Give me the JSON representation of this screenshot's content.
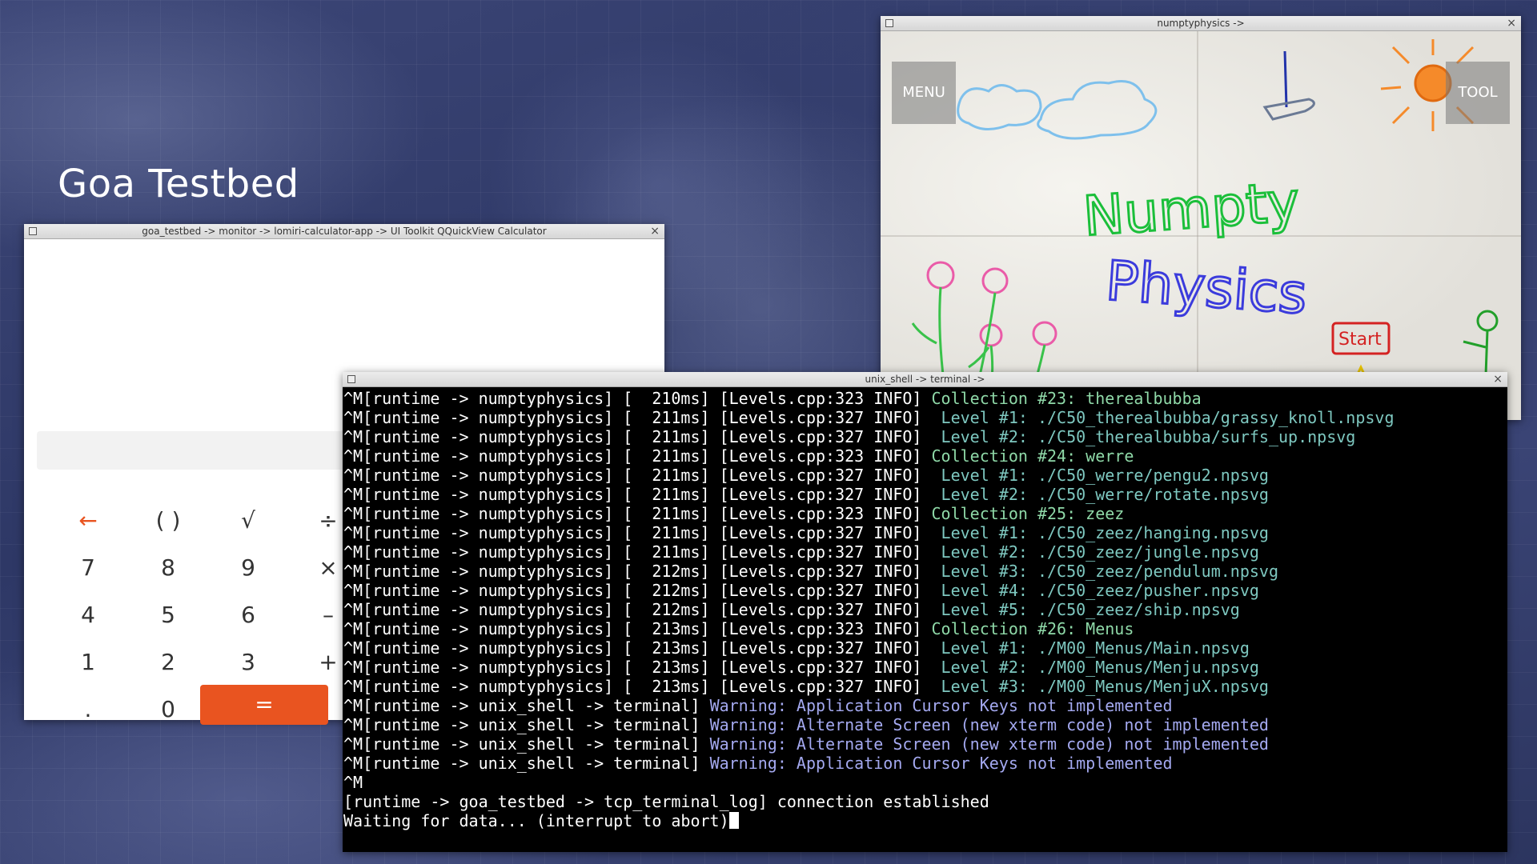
{
  "desktop": {
    "title": "Goa Testbed"
  },
  "calculator": {
    "window_title": "goa_testbed -> monitor -> lomiri-calculator-app -> UI Toolkit QQuickView Calculator",
    "close_label": "×",
    "keys": {
      "backspace": "←",
      "parens": "( )",
      "sqrt": "√",
      "divide": "÷",
      "k7": "7",
      "k8": "8",
      "k9": "9",
      "multiply": "×",
      "k4": "4",
      "k5": "5",
      "k6": "6",
      "minus": "–",
      "k1": "1",
      "k2": "2",
      "k3": "3",
      "plus": "+",
      "dot": ".",
      "k0": "0",
      "equals": "="
    },
    "accent": "#e95420"
  },
  "numpty": {
    "window_title": "numptyphysics ->",
    "close_label": "×",
    "menu_label": "MENU",
    "tool_label": "TOOL",
    "logo_line1": "Numpty",
    "logo_line2": "Physics",
    "start_label": "Start"
  },
  "terminal": {
    "window_title": "unix_shell -> terminal ->",
    "close_label": "×",
    "lines": [
      {
        "prefix": "^M[runtime -> numptyphysics] [  210ms] [Levels.cpp:323 INFO] ",
        "msg": "Collection #23: therealbubba",
        "kind": "coll"
      },
      {
        "prefix": "^M[runtime -> numptyphysics] [  211ms] [Levels.cpp:327 INFO] ",
        "msg": " Level #1: ./C50_therealbubba/grassy_knoll.npsvg",
        "kind": "level"
      },
      {
        "prefix": "^M[runtime -> numptyphysics] [  211ms] [Levels.cpp:327 INFO] ",
        "msg": " Level #2: ./C50_therealbubba/surfs_up.npsvg",
        "kind": "level"
      },
      {
        "prefix": "^M[runtime -> numptyphysics] [  211ms] [Levels.cpp:323 INFO] ",
        "msg": "Collection #24: werre",
        "kind": "coll"
      },
      {
        "prefix": "^M[runtime -> numptyphysics] [  211ms] [Levels.cpp:327 INFO] ",
        "msg": " Level #1: ./C50_werre/pengu2.npsvg",
        "kind": "level"
      },
      {
        "prefix": "^M[runtime -> numptyphysics] [  211ms] [Levels.cpp:327 INFO] ",
        "msg": " Level #2: ./C50_werre/rotate.npsvg",
        "kind": "level"
      },
      {
        "prefix": "^M[runtime -> numptyphysics] [  211ms] [Levels.cpp:323 INFO] ",
        "msg": "Collection #25: zeez",
        "kind": "coll"
      },
      {
        "prefix": "^M[runtime -> numptyphysics] [  211ms] [Levels.cpp:327 INFO] ",
        "msg": " Level #1: ./C50_zeez/hanging.npsvg",
        "kind": "level"
      },
      {
        "prefix": "^M[runtime -> numptyphysics] [  211ms] [Levels.cpp:327 INFO] ",
        "msg": " Level #2: ./C50_zeez/jungle.npsvg",
        "kind": "level"
      },
      {
        "prefix": "^M[runtime -> numptyphysics] [  212ms] [Levels.cpp:327 INFO] ",
        "msg": " Level #3: ./C50_zeez/pendulum.npsvg",
        "kind": "level"
      },
      {
        "prefix": "^M[runtime -> numptyphysics] [  212ms] [Levels.cpp:327 INFO] ",
        "msg": " Level #4: ./C50_zeez/pusher.npsvg",
        "kind": "level"
      },
      {
        "prefix": "^M[runtime -> numptyphysics] [  212ms] [Levels.cpp:327 INFO] ",
        "msg": " Level #5: ./C50_zeez/ship.npsvg",
        "kind": "level"
      },
      {
        "prefix": "^M[runtime -> numptyphysics] [  213ms] [Levels.cpp:323 INFO] ",
        "msg": "Collection #26: Menus",
        "kind": "coll"
      },
      {
        "prefix": "^M[runtime -> numptyphysics] [  213ms] [Levels.cpp:327 INFO] ",
        "msg": " Level #1: ./M00_Menus/Main.npsvg",
        "kind": "level"
      },
      {
        "prefix": "^M[runtime -> numptyphysics] [  213ms] [Levels.cpp:327 INFO] ",
        "msg": " Level #2: ./M00_Menus/Menju.npsvg",
        "kind": "level"
      },
      {
        "prefix": "^M[runtime -> numptyphysics] [  213ms] [Levels.cpp:327 INFO] ",
        "msg": " Level #3: ./M00_Menus/MenjuX.npsvg",
        "kind": "level"
      },
      {
        "prefix": "^M[runtime -> unix_shell -> terminal] ",
        "msg": "Warning: Application Cursor Keys not implemented",
        "kind": "warn"
      },
      {
        "prefix": "^M[runtime -> unix_shell -> terminal] ",
        "msg": "Warning: Alternate Screen (new xterm code) not implemented",
        "kind": "warn"
      },
      {
        "prefix": "^M[runtime -> unix_shell -> terminal] ",
        "msg": "Warning: Alternate Screen (new xterm code) not implemented",
        "kind": "warn"
      },
      {
        "prefix": "^M[runtime -> unix_shell -> terminal] ",
        "msg": "Warning: Application Cursor Keys not implemented",
        "kind": "warn"
      },
      {
        "prefix": "^M",
        "msg": "",
        "kind": "plain"
      },
      {
        "prefix": "[runtime -> goa_testbed -> tcp_terminal_log] connection established",
        "msg": "",
        "kind": "plain"
      },
      {
        "prefix": "Waiting for data... (interrupt to abort)",
        "msg": "",
        "kind": "prompt"
      }
    ]
  }
}
